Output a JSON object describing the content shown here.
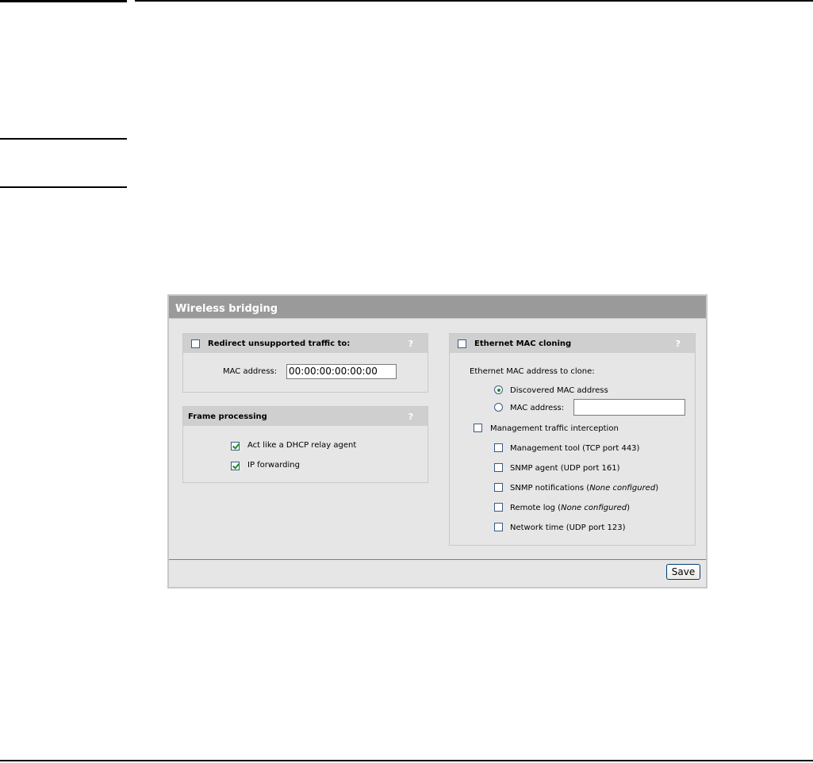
{
  "panel": {
    "title": "Wireless bridging",
    "help_glyph": "?",
    "redirect": {
      "label": "Redirect unsupported traffic to:",
      "checked": false,
      "mac_label": "MAC address:",
      "mac_value": "00:00:00:00:00:00"
    },
    "frame": {
      "label": "Frame processing",
      "items": [
        {
          "label": "Act like a DHCP relay agent",
          "checked": true
        },
        {
          "label": "IP forwarding",
          "checked": true
        }
      ]
    },
    "ethernet": {
      "label": "Ethernet MAC cloning",
      "checked": false,
      "clone_label": "Ethernet MAC address to clone:",
      "opt_discovered": "Discovered MAC address",
      "opt_mac": "MAC address:",
      "selected": "discovered",
      "mac_value": "",
      "intercept_label": "Management traffic interception",
      "items": [
        {
          "label": "Management tool (TCP port 443)",
          "note": ""
        },
        {
          "label": "SNMP agent (UDP port 161)",
          "note": ""
        },
        {
          "label": "SNMP notifications (",
          "note": "None configured",
          "tail": ")"
        },
        {
          "label": "Remote log (",
          "note": "None configured",
          "tail": ")"
        },
        {
          "label": "Network time (UDP port 123)",
          "note": ""
        }
      ]
    },
    "save_label": "Save"
  }
}
